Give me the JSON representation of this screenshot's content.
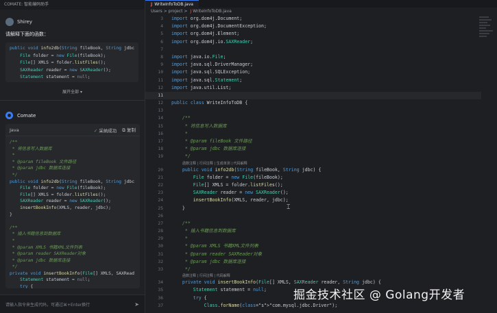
{
  "chat": {
    "header": "COMATE: 智能编码助手",
    "user_name": "Shirey",
    "prompt": "请解释下面的函数：",
    "user_snippet": [
      "public void info2db(String fileBook, String jdbc",
      "    File folder = new File(fileBook);",
      "    File[] XMLS = folder.listFiles();",
      "    SAXReader reader = new SAXReader();",
      "    Statement statement = null;"
    ],
    "expand_label": "展开全部 ▾",
    "assistant_name": "Comate",
    "code_lang": "Java",
    "adopted_label": "采纳成功",
    "copy_label": "复制",
    "answer_code": [
      "/**",
      " * 将信息写入数据库",
      " *",
      " * @param fileBook 文件路径",
      " * @param jdbc 数据库连接",
      " */",
      "public void info2db(String fileBook, String jdbc",
      "    File folder = new File(fileBook);",
      "    File[] XMLS = folder.listFiles();",
      "    SAXReader reader = new SAXReader();",
      "    insertBookInfo(XMLS, reader, jdbc);",
      "}",
      "",
      "/**",
      " * 插入书籍信息到数据库",
      " *",
      " * @param XMLS 书籍XML文件列表",
      " * @param reader SAXReader对象",
      " * @param jdbc 数据库连接",
      " */",
      "private void insertBookInfo(File[] XMLS, SAXRead",
      "    Statement statement = null;",
      "    try {",
      "        Class.forName(\"com.mysql.jdbc.Driver\");"
    ],
    "input_placeholder": "请输入指令来生成代码，可通过⌘+Enter换行"
  },
  "editor": {
    "tab_label": "WriteInfoToDB.java",
    "breadcrumb": [
      "Users",
      "project",
      "WriteInfoToDB.java"
    ],
    "lines": [
      {
        "n": "3",
        "code": "import org.dom4j.Document;"
      },
      {
        "n": "4",
        "code": "import org.dom4j.DocumentException;"
      },
      {
        "n": "5",
        "code": "import org.dom4j.Element;"
      },
      {
        "n": "6",
        "code": "import org.dom4j.io.SAXReader;"
      },
      {
        "n": "7",
        "code": ""
      },
      {
        "n": "8",
        "code": "import java.io.File;"
      },
      {
        "n": "9",
        "code": "import java.sql.DriverManager;"
      },
      {
        "n": "10",
        "code": "import java.sql.SQLException;"
      },
      {
        "n": "11",
        "code": "import java.sql.Statement;"
      },
      {
        "n": "12",
        "code": "import java.util.List;"
      },
      {
        "n": "11",
        "code": ""
      },
      {
        "n": "12",
        "code": "public class WriteInfoToDB {"
      },
      {
        "n": "13",
        "code": ""
      },
      {
        "n": "14",
        "code": "    /**"
      },
      {
        "n": "15",
        "code": "     * 将信息写入数据库"
      },
      {
        "n": "16",
        "code": "     *"
      },
      {
        "n": "17",
        "code": "     * @param fileBook 文件路径"
      },
      {
        "n": "18",
        "code": "     * @param jdbc 数据库连接"
      },
      {
        "n": "19",
        "code": "     */"
      },
      {
        "n": "20",
        "code": "    public void info2db(String fileBook, String jdbc) {",
        "lens": "函数注释 | 行间注释 | 生成单测 | 代码解释"
      },
      {
        "n": "21",
        "code": "        File folder = new File(fileBook);"
      },
      {
        "n": "22",
        "code": "        File[] XMLS = folder.listFiles();"
      },
      {
        "n": "23",
        "code": "        SAXReader reader = new SAXReader();"
      },
      {
        "n": "24",
        "code": "        insertBookInfo(XMLS, reader, jdbc);"
      },
      {
        "n": "25",
        "code": "    }"
      },
      {
        "n": "26",
        "code": ""
      },
      {
        "n": "27",
        "code": "    /**"
      },
      {
        "n": "28",
        "code": "     * 插入书籍信息到数据库"
      },
      {
        "n": "29",
        "code": "     *"
      },
      {
        "n": "30",
        "code": "     * @param XMLS 书籍XML文件列表"
      },
      {
        "n": "31",
        "code": "     * @param reader SAXReader对象"
      },
      {
        "n": "32",
        "code": "     * @param jdbc 数据库连接"
      },
      {
        "n": "33",
        "code": "     */"
      },
      {
        "n": "34",
        "code": "    private void insertBookInfo(File[] XMLS, SAXReader reader, String jdbc) {",
        "lens": "函数注释 | 行间注释 | 代码解释"
      },
      {
        "n": "35",
        "code": "        Statement statement = null;"
      },
      {
        "n": "36",
        "code": "        try {"
      },
      {
        "n": "37",
        "code": "            Class.forName(\"com.mysql.jdbc.Driver\");"
      }
    ]
  },
  "watermark": "掘金技术社区 @ Golang开发者"
}
